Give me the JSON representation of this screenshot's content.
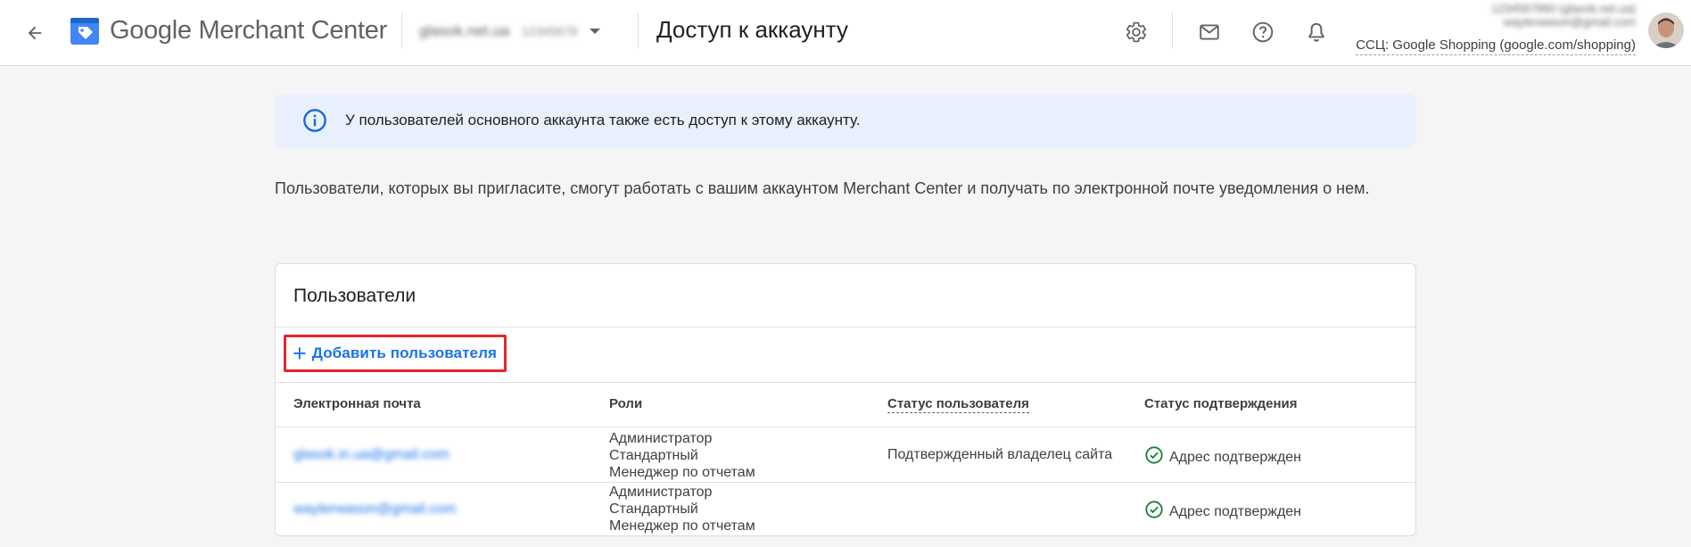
{
  "header": {
    "brand": "Google Merchant Center",
    "account_name": "glasok.net.ua",
    "account_id": "12345678",
    "page_title": "Доступ к аккаунту",
    "user_name": "1234567890 (glasok.net.ua)",
    "user_email": "wayterwason@gmail.com",
    "css_label": "ССЦ: Google Shopping (google.com/shopping)"
  },
  "banner": {
    "text": "У пользователей основного аккаунта также есть доступ к этому аккаунту."
  },
  "intro_text": "Пользователи, которых вы пригласите, смогут работать с вашим аккаунтом Merchant Center и получать по электронной почте уведомления о нем.",
  "users": {
    "title": "Пользователи",
    "add_button_label": "Добавить пользователя",
    "columns": {
      "email": "Электронная почта",
      "roles": "Роли",
      "user_status": "Статус пользователя",
      "confirm_status": "Статус подтверждения"
    },
    "rows": [
      {
        "email": "glasok.in.ua@gmail.com",
        "roles": [
          "Администратор",
          "Стандартный",
          "Менеджер по отчетам"
        ],
        "user_status": "Подтвержденный владелец сайта",
        "confirm_status": "Адрес подтвержден"
      },
      {
        "email": "wayterwason@gmail.com",
        "roles": [
          "Администратор",
          "Стандартный",
          "Менеджер по отчетам"
        ],
        "user_status": "",
        "confirm_status": "Адрес подтвержден"
      }
    ]
  },
  "colors": {
    "accent": "#1a73e8",
    "highlight_border": "#e3262b",
    "banner_bg": "#e8f0fe",
    "success": "#188038"
  },
  "icons": [
    "back-arrow-icon",
    "merchant-center-logo-icon",
    "settings-gear-icon",
    "mail-icon",
    "help-icon",
    "bell-icon",
    "info-icon",
    "plus-icon",
    "check-circle-icon"
  ]
}
